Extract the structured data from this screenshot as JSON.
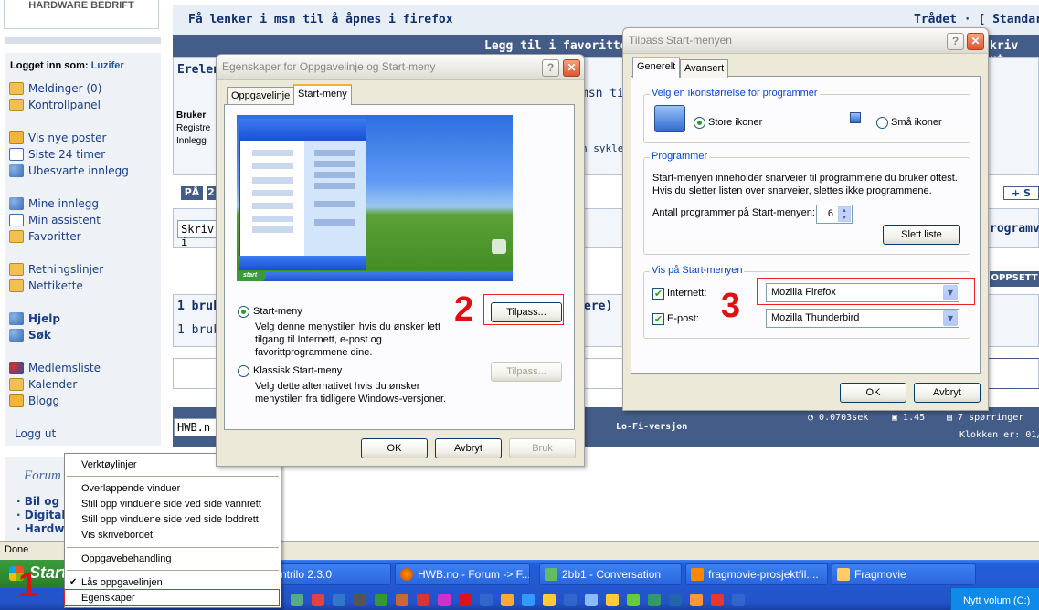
{
  "forum": {
    "logo_text": "HARDWARE BEDRIFT",
    "logged_in_label": "Logget inn som:",
    "username": "Luzifer",
    "nav_group1": [
      "Meldinger (0)",
      "Kontrollpanel"
    ],
    "nav_group2": [
      "Vis nye poster",
      "Siste 24 timer",
      "Ubesvarte innlegg"
    ],
    "nav_group3": [
      "Mine innlegg",
      "Min assistent",
      "Favoritter"
    ],
    "nav_group4": [
      "Retningslinjer",
      "Nettikette"
    ],
    "nav_group5": [
      "Hjelp",
      "Søk"
    ],
    "nav_group6": [
      "Medlemsliste",
      "Kalender",
      "Blogg"
    ],
    "logout": "Logg ut",
    "forum_label": "Forum",
    "forum_links": [
      "· Bil og m",
      "· Digital",
      "· Hardwa"
    ],
    "thread_title": "Få lenker i msn til å åpnes i firefox",
    "thread_right": "Trådet · [ Standard",
    "add_favorite": "Legg til i favoritter",
    "fav_right": "kriv ut",
    "post_user_partial": "Erelen",
    "post_text_partial": "msn til",
    "bruker_label": "Bruker",
    "registr_partial": "Registre",
    "innlegg_partial": "Innlegg",
    "sykle_partial": "n sykle!",
    "btn_pa": "PÅ",
    "btn_2": "2",
    "skriv_partial": "Skriv i",
    "add_btn": "+ S",
    "program_partial": "rogramv",
    "oppsett": "OPPSETT",
    "users_row1": "1 bruk",
    "users_row1_right": "ere)",
    "users_row2": "1 bruke",
    "hwb_field": "HWB.n",
    "lofi": "Lo-Fi-versjon",
    "timing": "0.0703sek",
    "load": "1.45",
    "queries": "7 spørringer",
    "clock": "Klokken er: 01/"
  },
  "browser_status": "Done",
  "taskbar": {
    "start": "Start",
    "tasks": [
      "ntrilo 2.3.0",
      "HWB.no - Forum -> F...",
      "2bb1 - Conversation",
      "fragmovie-prosjektfil....",
      "Fragmovie"
    ],
    "tray_text": "Nytt volum (C:)"
  },
  "context_menu": {
    "items": [
      "Verktøylinjer",
      "Overlappende vinduer",
      "Still opp vinduene side ved side vannrett",
      "Still opp vinduene side ved side loddrett",
      "Vis skrivebordet",
      "Oppgavebehandling",
      "Lås oppgavelinjen",
      "Egenskaper"
    ],
    "submenu_arrow": "▶",
    "check": "✔"
  },
  "dialog1": {
    "title": "Egenskaper for Oppgavelinje og Start-meny",
    "tabs": [
      "Oppgavelinje",
      "Start-meny"
    ],
    "opt1_label": "Start-meny",
    "opt1_desc": "Velg denne menystilen hvis du ønsker lett tilgang til Internett, e-post og favorittprogrammene dine.",
    "opt2_label": "Klassisk Start-meny",
    "opt2_desc": "Velg dette alternativet hvis du ønsker menystilen fra tidligere Windows-versjoner.",
    "customize": "Tilpass...",
    "customize_disabled": "Tilpass...",
    "ok": "OK",
    "cancel": "Avbryt",
    "apply": "Bruk",
    "help": "?",
    "close": "✕",
    "preview_start": "start"
  },
  "dialog2": {
    "title": "Tilpass Start-menyen",
    "tabs": [
      "Generelt",
      "Avansert"
    ],
    "icon_group": "Velg en ikonstørrelse for programmer",
    "large_icons": "Store ikoner",
    "small_icons": "Små ikoner",
    "prog_group": "Programmer",
    "prog_desc1": "Start-menyen inneholder snarveier til programmene du bruker oftest.",
    "prog_desc2": "Hvis du sletter listen over snarveier, slettes ikke programmene.",
    "count_label": "Antall programmer på Start-menyen:",
    "count_value": "6",
    "clear_list": "Slett liste",
    "show_group": "Vis på Start-menyen",
    "internet_label": "Internett:",
    "internet_value": "Mozilla Firefox",
    "email_label": "E-post:",
    "email_value": "Mozilla Thunderbird",
    "ok": "OK",
    "cancel": "Avbryt",
    "help": "?",
    "close": "✕"
  },
  "steps": [
    "1",
    "2",
    "3"
  ],
  "colors": {
    "accent_red": "#e01010",
    "xp_blue": "#245edb",
    "forum_navy": "#445c88"
  }
}
